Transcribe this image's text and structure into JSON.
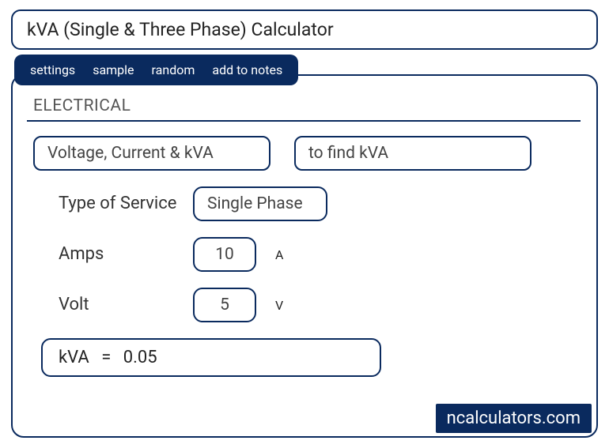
{
  "title": "kVA (Single & Three Phase) Calculator",
  "tabs": {
    "settings": "settings",
    "sample": "sample",
    "random": "random",
    "add_to_notes": "add to notes"
  },
  "section": "ELECTRICAL",
  "selects": {
    "mode": "Voltage, Current & kVA",
    "goal": "to find kVA"
  },
  "fields": {
    "service_label": "Type of Service",
    "service_value": "Single Phase",
    "amps_label": "Amps",
    "amps_value": "10",
    "amps_unit": "A",
    "volt_label": "Volt",
    "volt_value": "5",
    "volt_unit": "V"
  },
  "result": {
    "label": "kVA",
    "eq": "=",
    "value": "0.05"
  },
  "watermark": "ncalculators.com"
}
